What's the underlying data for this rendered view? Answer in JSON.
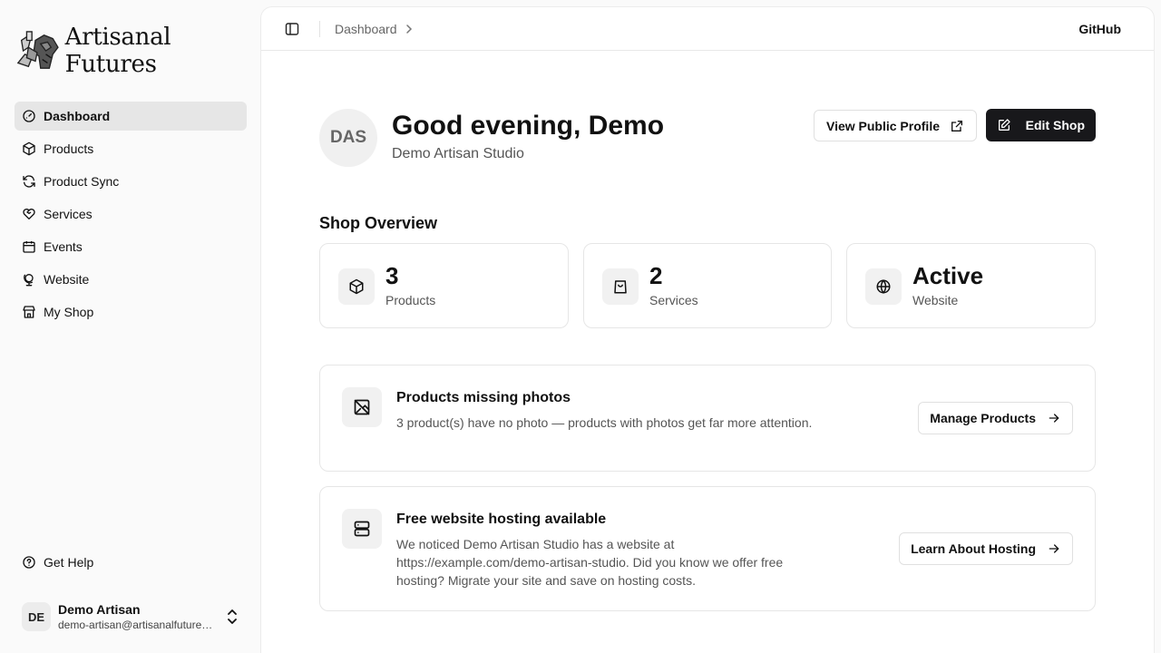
{
  "brand": {
    "name": "Artisanal Futures",
    "logo_icon": "hands-logo"
  },
  "sidebar": {
    "items": [
      {
        "label": "Dashboard",
        "icon": "gauge-icon",
        "active": true
      },
      {
        "label": "Products",
        "icon": "package-icon"
      },
      {
        "label": "Product Sync",
        "icon": "refresh-icon"
      },
      {
        "label": "Services",
        "icon": "heart-handshake-icon"
      },
      {
        "label": "Events",
        "icon": "calendar-icon"
      },
      {
        "label": "Website",
        "icon": "globe-stand-icon"
      },
      {
        "label": "My Shop",
        "icon": "store-icon"
      }
    ],
    "help_label": "Get Help",
    "user": {
      "initials": "DE",
      "name": "Demo Artisan",
      "email": "demo-artisan@artisanalfutures.org"
    }
  },
  "topbar": {
    "breadcrumb": "Dashboard",
    "github": "GitHub"
  },
  "greeting": {
    "avatar": "DAS",
    "title": "Good evening, Demo",
    "subtitle": "Demo Artisan Studio",
    "view_profile": "View Public Profile",
    "edit_shop": "Edit Shop"
  },
  "overview": {
    "title": "Shop Overview",
    "stats": [
      {
        "value": "3",
        "label": "Products",
        "icon": "package-icon"
      },
      {
        "value": "2",
        "label": "Services",
        "icon": "shopping-bag-icon"
      },
      {
        "value": "Active",
        "label": "Website",
        "icon": "globe-icon"
      }
    ]
  },
  "cards": [
    {
      "title": "Products missing photos",
      "text": "3 product(s) have no photo — products with photos get far more attention.",
      "button": "Manage Products",
      "icon": "image-off-icon"
    },
    {
      "title": "Free website hosting available",
      "text": "We noticed Demo Artisan Studio has a website at https://example.com/demo-artisan-studio. Did you know we offer free hosting? Migrate your site and save on hosting costs.",
      "button": "Learn About Hosting",
      "icon": "server-icon"
    }
  ],
  "colors": {
    "accent_dark": "#18181b",
    "active_nav": "#e6e6e6",
    "background": "#fafafa"
  }
}
